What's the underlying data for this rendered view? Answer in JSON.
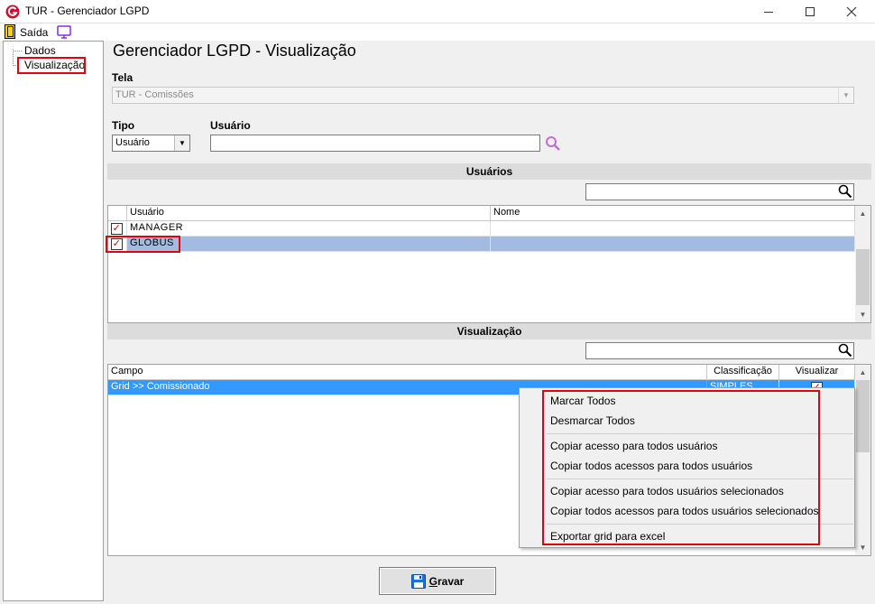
{
  "window": {
    "title": "TUR - Gerenciador LGPD"
  },
  "menu": {
    "exit_label": "Saída"
  },
  "tree": {
    "items": [
      "Dados",
      "Visualização"
    ]
  },
  "page": {
    "title": "Gerenciador LGPD - Visualização"
  },
  "tela": {
    "label": "Tela",
    "value": "TUR - Comissões"
  },
  "tipo": {
    "label": "Tipo",
    "value": "Usuário"
  },
  "usuario": {
    "label": "Usuário",
    "value": ""
  },
  "usuarios_section": {
    "title": "Usuários",
    "filter_value": "",
    "columns": [
      "Usuário",
      "Nome"
    ],
    "rows": [
      {
        "checked": true,
        "usuario": "MANAGER",
        "nome": ""
      },
      {
        "checked": true,
        "usuario": "GLOBUS",
        "nome": ""
      }
    ]
  },
  "vis_section": {
    "title": "Visualização",
    "filter_value": "",
    "columns": [
      "Campo",
      "Classificação",
      "Visualizar"
    ],
    "rows": [
      {
        "campo": "Grid >> Comissionado",
        "classificacao": "SIMPLES",
        "visualizar": true
      }
    ]
  },
  "context_menu": {
    "items": [
      "Marcar Todos",
      "Desmarcar Todos",
      "Copiar acesso para todos usuários",
      "Copiar todos acessos para todos usuários",
      "Copiar acesso para todos usuários selecionados",
      "Copiar todos acessos para todos usuários selecionados",
      "Exportar grid para excel"
    ]
  },
  "actions": {
    "save_label_first": "G",
    "save_label_rest": "ravar"
  },
  "colors": {
    "highlight_red": "#e3000f",
    "row_selected": "#a3bbe0",
    "row_active": "#3399ff"
  }
}
